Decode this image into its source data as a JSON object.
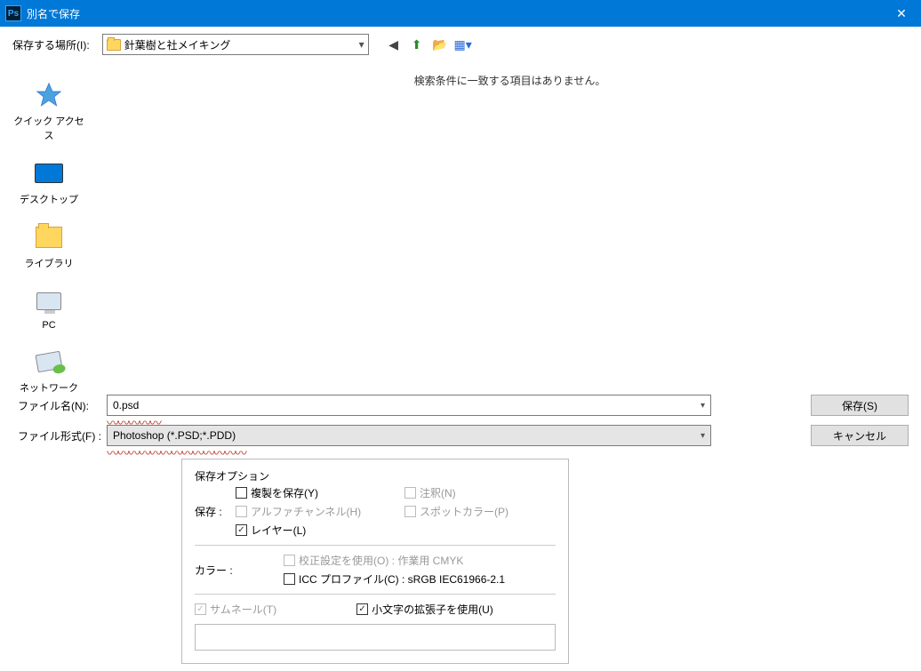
{
  "titlebar": {
    "app_icon": "Ps",
    "title": "別名で保存"
  },
  "toolbar": {
    "lookin_label": "保存する場所(I):",
    "current_folder": "針葉樹と社メイキング",
    "icons": {
      "back": "←",
      "up": "↑",
      "newfolder": "📁",
      "views": "▦"
    }
  },
  "places": [
    {
      "name": "quick-access",
      "label": "クイック アクセス"
    },
    {
      "name": "desktop",
      "label": "デスクトップ"
    },
    {
      "name": "libraries",
      "label": "ライブラリ"
    },
    {
      "name": "pc",
      "label": "PC"
    },
    {
      "name": "network",
      "label": "ネットワーク"
    }
  ],
  "file_list": {
    "empty_message": "検索条件に一致する項目はありません。"
  },
  "fields": {
    "filename_label": "ファイル名(N):",
    "filename_value": "0.psd",
    "format_label": "ファイル形式(F) :",
    "format_value": "Photoshop (*.PSD;*.PDD)"
  },
  "buttons": {
    "save": "保存(S)",
    "cancel": "キャンセル"
  },
  "options": {
    "panel_title": "保存オプション",
    "save_label": "保存 :",
    "copy": "複製を保存(Y)",
    "annotations": "注釈(N)",
    "alpha": "アルファチャンネル(H)",
    "spot": "スポットカラー(P)",
    "layers": "レイヤー(L)",
    "color_label": "カラー :",
    "proof": "校正設定を使用(O) : 作業用 CMYK",
    "icc": "ICC プロファイル(C) : sRGB IEC61966-2.1",
    "thumbnail": "サムネール(T)",
    "lowercase": "小文字の拡張子を使用(U)"
  }
}
